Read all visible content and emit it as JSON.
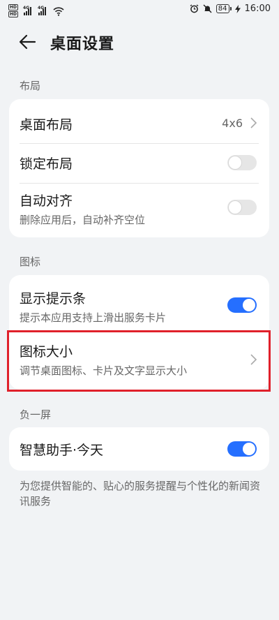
{
  "status_bar": {
    "sim1": "HD",
    "sim2": "HD",
    "net1": "4G",
    "net2": "4G",
    "battery": "84",
    "time": "16:00"
  },
  "header": {
    "title": "桌面设置"
  },
  "sections": {
    "layout": {
      "label": "布局",
      "desktop_layout": {
        "title": "桌面布局",
        "value": "4x6"
      },
      "lock_layout": {
        "title": "锁定布局",
        "enabled": false
      },
      "auto_align": {
        "title": "自动对齐",
        "subtitle": "删除应用后，自动补齐空位",
        "enabled": false
      }
    },
    "icons": {
      "label": "图标",
      "show_hint_bar": {
        "title": "显示提示条",
        "subtitle": "提示本应用支持上滑出服务卡片",
        "enabled": true
      },
      "icon_size": {
        "title": "图标大小",
        "subtitle": "调节桌面图标、卡片及文字显示大小"
      }
    },
    "minus_one_screen": {
      "label": "负一屏",
      "smart_assistant": {
        "title": "智慧助手·今天",
        "enabled": true
      },
      "footnote": "为您提供智能的、贴心的服务提醒与个性化的新闻资讯服务"
    }
  },
  "colors": {
    "accent": "#256fff",
    "highlight": "#e0212b",
    "background": "#f1f3f5"
  }
}
